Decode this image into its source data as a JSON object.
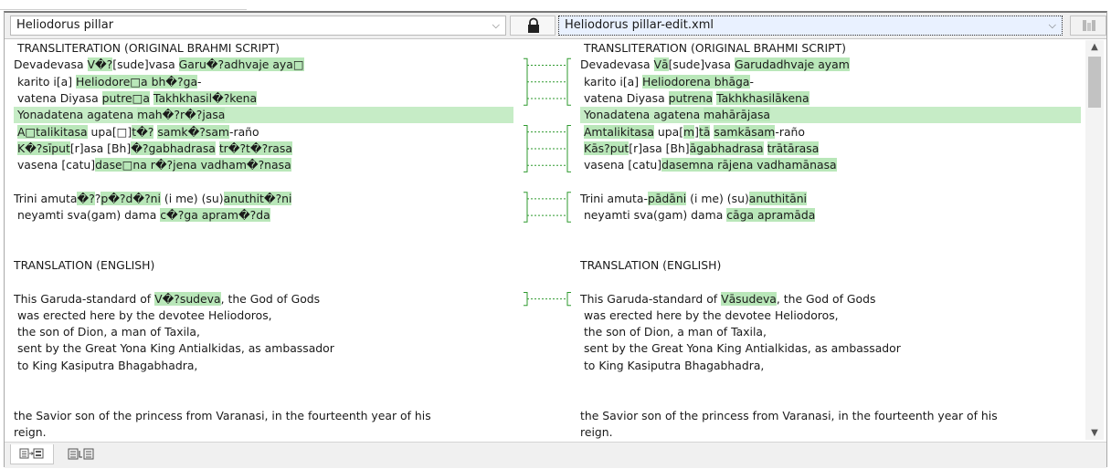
{
  "header": {
    "left_file": "Heliodorus pillar",
    "right_file": "Heliodorus pillar-edit.xml",
    "dropdown_glyph": "⌵",
    "lock_icon": "lock-icon",
    "options_icon": "diff-options-icon"
  },
  "left_lines": [
    {
      "segs": [
        {
          "t": " TRANSLITERATION (ORIGINAL BRAHMI SCRIPT)"
        }
      ]
    },
    {
      "segs": [
        {
          "t": "Devadevasa "
        },
        {
          "t": "V�?",
          "h": true
        },
        {
          "t": "[sude]vasa "
        },
        {
          "t": "Garu�?adhvaje aya□",
          "h": true
        }
      ]
    },
    {
      "segs": [
        {
          "t": " karito i[a] "
        },
        {
          "t": "Heliodore□a bh�?ga",
          "h": true
        },
        {
          "t": "-"
        }
      ]
    },
    {
      "segs": [
        {
          "t": " vatena Diyasa "
        },
        {
          "t": "putre□a",
          "h": true
        },
        {
          "t": " "
        },
        {
          "t": "Takhkhasil�?kena",
          "h": true
        }
      ]
    },
    {
      "full": true,
      "segs": [
        {
          "t": " Yonadatena agatena "
        },
        {
          "t": "mah�?r�?jasa",
          "h": true
        }
      ]
    },
    {
      "segs": [
        {
          "t": " "
        },
        {
          "t": "A□talikitasa",
          "h": true
        },
        {
          "t": " upa[□]"
        },
        {
          "t": "t�?",
          "h": true
        },
        {
          "t": " "
        },
        {
          "t": "samk�?sam",
          "h": true
        },
        {
          "t": "-raño"
        }
      ]
    },
    {
      "segs": [
        {
          "t": " "
        },
        {
          "t": "K�?sīput",
          "h": true
        },
        {
          "t": "[r]asa [Bh]"
        },
        {
          "t": "�?gabhadrasa",
          "h": true
        },
        {
          "t": " "
        },
        {
          "t": "tr�?t�?rasa",
          "h": true
        }
      ]
    },
    {
      "segs": [
        {
          "t": " vasena [catu]"
        },
        {
          "t": "dase□na r�?jena vadham�?nasa",
          "h": true
        }
      ]
    },
    {
      "segs": [
        {
          "t": ""
        }
      ]
    },
    {
      "segs": [
        {
          "t": "Trini amuta"
        },
        {
          "t": "�?",
          "h": true
        },
        {
          "t": "?"
        },
        {
          "t": "p�?d�?ni",
          "h": true
        },
        {
          "t": " (i me) (su)"
        },
        {
          "t": "anuthit�?ni",
          "h": true
        }
      ]
    },
    {
      "segs": [
        {
          "t": " neyamti sva(gam) dama "
        },
        {
          "t": "c�?ga apram�?da",
          "h": true
        }
      ]
    },
    {
      "segs": [
        {
          "t": ""
        }
      ]
    },
    {
      "segs": [
        {
          "t": ""
        }
      ]
    },
    {
      "segs": [
        {
          "t": "TRANSLATION (ENGLISH)"
        }
      ]
    },
    {
      "segs": [
        {
          "t": ""
        }
      ]
    },
    {
      "segs": [
        {
          "t": "This Garuda-standard of "
        },
        {
          "t": "V�?sudeva",
          "h": true
        },
        {
          "t": ", the God of Gods"
        }
      ]
    },
    {
      "segs": [
        {
          "t": " was erected here by the devotee Heliodoros,"
        }
      ]
    },
    {
      "segs": [
        {
          "t": " the son of Dion, a man of Taxila,"
        }
      ]
    },
    {
      "segs": [
        {
          "t": " sent by the Great Yona King Antialkidas, as ambassador"
        }
      ]
    },
    {
      "segs": [
        {
          "t": " to King Kasiputra Bhagabhadra,"
        }
      ]
    },
    {
      "segs": [
        {
          "t": ""
        }
      ]
    },
    {
      "segs": [
        {
          "t": ""
        }
      ]
    },
    {
      "segs": [
        {
          "t": "the Savior son of the princess from Varanasi, in the fourteenth year of his"
        }
      ]
    },
    {
      "segs": [
        {
          "t": "reign."
        }
      ]
    }
  ],
  "right_lines": [
    {
      "segs": [
        {
          "t": " TRANSLITERATION (ORIGINAL BRAHMI SCRIPT)"
        }
      ]
    },
    {
      "segs": [
        {
          "t": "Devadevasa "
        },
        {
          "t": "Vā",
          "h": true
        },
        {
          "t": "[sude]vasa "
        },
        {
          "t": "Garudadhvaje ayam",
          "h": true
        }
      ]
    },
    {
      "segs": [
        {
          "t": " karito i[a] "
        },
        {
          "t": "Heliodorena bhāga",
          "h": true
        },
        {
          "t": "-"
        }
      ]
    },
    {
      "segs": [
        {
          "t": " vatena Diyasa "
        },
        {
          "t": "putrena",
          "h": true
        },
        {
          "t": " "
        },
        {
          "t": "Takhkhasilākena",
          "h": true
        }
      ]
    },
    {
      "full": true,
      "segs": [
        {
          "t": " Yonadatena agatena "
        },
        {
          "t": "mahārājasa",
          "h": true
        }
      ]
    },
    {
      "segs": [
        {
          "t": " "
        },
        {
          "t": "Amtalikitasa",
          "h": true
        },
        {
          "t": " upa["
        },
        {
          "t": "m",
          "h": true
        },
        {
          "t": "]"
        },
        {
          "t": "tā",
          "h": true
        },
        {
          "t": " "
        },
        {
          "t": "samkāsam",
          "h": true
        },
        {
          "t": "-raño"
        }
      ]
    },
    {
      "segs": [
        {
          "t": " "
        },
        {
          "t": "Kās?put",
          "h": true
        },
        {
          "t": "[r]asa [Bh]"
        },
        {
          "t": "āgabhadrasa",
          "h": true
        },
        {
          "t": " "
        },
        {
          "t": "trātārasa",
          "h": true
        }
      ]
    },
    {
      "segs": [
        {
          "t": " vasena [catu]"
        },
        {
          "t": "dasemna rājena vadhamānasa",
          "h": true
        }
      ]
    },
    {
      "segs": [
        {
          "t": ""
        }
      ]
    },
    {
      "segs": [
        {
          "t": "Trini amuta-"
        },
        {
          "t": "pādāni",
          "h": true
        },
        {
          "t": " (i me) (su)"
        },
        {
          "t": "anuthitāni",
          "h": true
        }
      ]
    },
    {
      "segs": [
        {
          "t": " neyamti sva(gam) dama "
        },
        {
          "t": "cāga apramāda",
          "h": true
        }
      ]
    },
    {
      "segs": [
        {
          "t": ""
        }
      ]
    },
    {
      "segs": [
        {
          "t": ""
        }
      ]
    },
    {
      "segs": [
        {
          "t": "TRANSLATION (ENGLISH)"
        }
      ]
    },
    {
      "segs": [
        {
          "t": ""
        }
      ]
    },
    {
      "segs": [
        {
          "t": "This Garuda-standard of "
        },
        {
          "t": "Vāsudeva",
          "h": true
        },
        {
          "t": ", the God of Gods"
        }
      ]
    },
    {
      "segs": [
        {
          "t": " was erected here by the devotee Heliodoros,"
        }
      ]
    },
    {
      "segs": [
        {
          "t": " the son of Dion, a man of Taxila,"
        }
      ]
    },
    {
      "segs": [
        {
          "t": " sent by the Great Yona King Antialkidas, as ambassador"
        }
      ]
    },
    {
      "segs": [
        {
          "t": " to King Kasiputra Bhagabhadra,"
        }
      ]
    },
    {
      "segs": [
        {
          "t": ""
        }
      ]
    },
    {
      "segs": [
        {
          "t": ""
        }
      ]
    },
    {
      "segs": [
        {
          "t": "the Savior son of the princess from Varanasi, in the fourteenth year of his"
        }
      ]
    },
    {
      "segs": [
        {
          "t": "reign."
        }
      ]
    }
  ],
  "connected_lines": [
    1,
    2,
    3,
    5,
    6,
    7,
    9,
    10,
    15
  ],
  "colors": {
    "highlight": "#b9e7b9",
    "full_line": "#c6ecc6",
    "connector": "#2e9a2e"
  },
  "footer": {
    "tabs": [
      {
        "icon": "insert-text-icon",
        "active": true
      },
      {
        "icon": "merge-text-icon",
        "active": false
      }
    ]
  },
  "scrollbar": {
    "up": "▲",
    "down": "▼"
  }
}
